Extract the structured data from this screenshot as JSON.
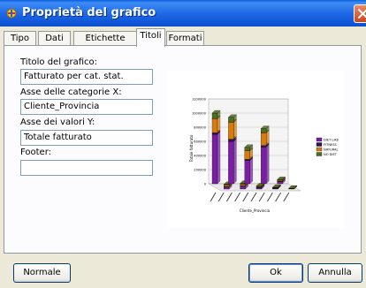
{
  "window": {
    "title": "Proprietà del grafico"
  },
  "tabs": [
    {
      "label": "Tipo"
    },
    {
      "label": "Dati"
    },
    {
      "label": "Etichette serie"
    },
    {
      "label": "Titoli",
      "active": true
    },
    {
      "label": "Formati"
    }
  ],
  "fields": {
    "chart_title": {
      "label": "Titolo del grafico:",
      "value": "Fatturato per cat. stat."
    },
    "category_axis": {
      "label": "Asse delle categorie X:",
      "value": "Cliente_Provincia"
    },
    "value_axis": {
      "label": "Asse dei valori Y:",
      "value": "Totale fatturato"
    },
    "footer": {
      "label": "Footer:",
      "value": ""
    }
  },
  "buttons": {
    "normal": "Normale",
    "ok": "Ok",
    "cancel": "Annulla"
  },
  "colors": {
    "purple": "#7a1fa3",
    "orange": "#d97a0d",
    "green": "#4f6d1f",
    "dark": "#2b1550"
  },
  "chart_data": {
    "type": "bar",
    "stacked": true,
    "three_d": true,
    "xlabel": "Cliente_Provincia",
    "ylabel": "Totale fatturato",
    "ylim": [
      0,
      1200000
    ],
    "y_ticks": [
      "0",
      "200000",
      "400000",
      "600000",
      "800000",
      "1000000",
      "1200000"
    ],
    "categories": [
      "",
      "",
      "",
      "",
      "",
      "",
      "",
      "",
      "",
      ""
    ],
    "series": [
      {
        "name": "DIET LIKE",
        "values": [
          700000,
          30000,
          600000,
          40000,
          330000,
          20000,
          520000,
          10000,
          30000,
          5000
        ]
      },
      {
        "name": "FITNESS",
        "values": [
          20000,
          5000,
          30000,
          5000,
          15000,
          5000,
          20000,
          5000,
          5000,
          2000
        ]
      },
      {
        "name": "NATURAL",
        "values": [
          200000,
          20000,
          240000,
          20000,
          120000,
          10000,
          180000,
          5000,
          15000,
          2000
        ]
      },
      {
        "name": "NO DIET",
        "values": [
          80000,
          10000,
          70000,
          15000,
          50000,
          10000,
          60000,
          5000,
          10000,
          2000
        ]
      }
    ],
    "legend": "right",
    "grid": true
  }
}
